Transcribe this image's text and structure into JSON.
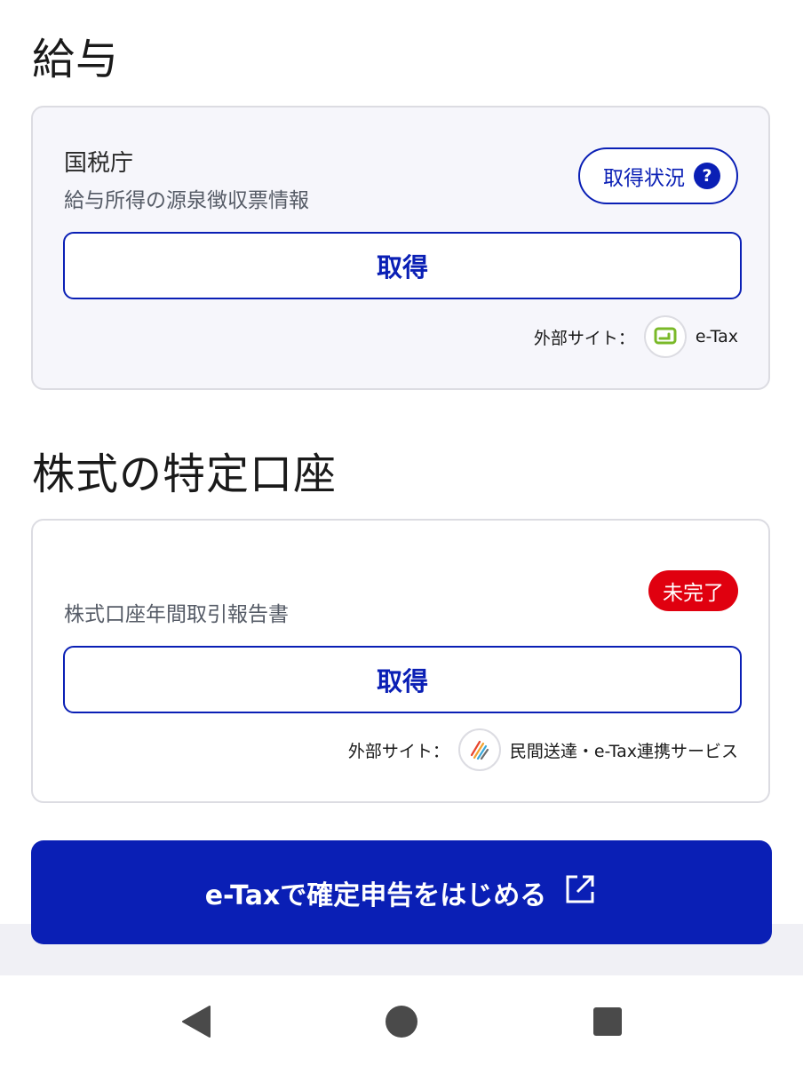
{
  "salary": {
    "section_title": "給与",
    "provider": "国税庁",
    "subtitle": "給与所得の源泉徴収票情報",
    "status_button_label": "取得状況",
    "help_symbol": "?",
    "get_button_label": "取得",
    "external_label": "外部サイト：",
    "external_site_name": "e-Tax",
    "logo_icon": "etax-logo-icon",
    "logo_color": "#7ab928"
  },
  "stock": {
    "section_title": "株式の特定口座",
    "badge_label": "未完了",
    "subtitle": "株式口座年間取引報告書",
    "get_button_label": "取得",
    "external_label": "外部サイト：",
    "external_site_name": "民間送達・e-Tax連携サービス",
    "logo_icon": "stripes-logo-icon"
  },
  "cta": {
    "label": "e-Taxで確定申告をはじめる",
    "icon": "external-link-icon"
  },
  "nav": {
    "back": "back-triangle-icon",
    "home": "home-circle-icon",
    "recents": "recents-square-icon"
  },
  "colors": {
    "primary": "#0a1fb5",
    "badge_red": "#e0000f",
    "card_tint": "#f6f6fb",
    "nav_gray": "#4a4a4a"
  }
}
